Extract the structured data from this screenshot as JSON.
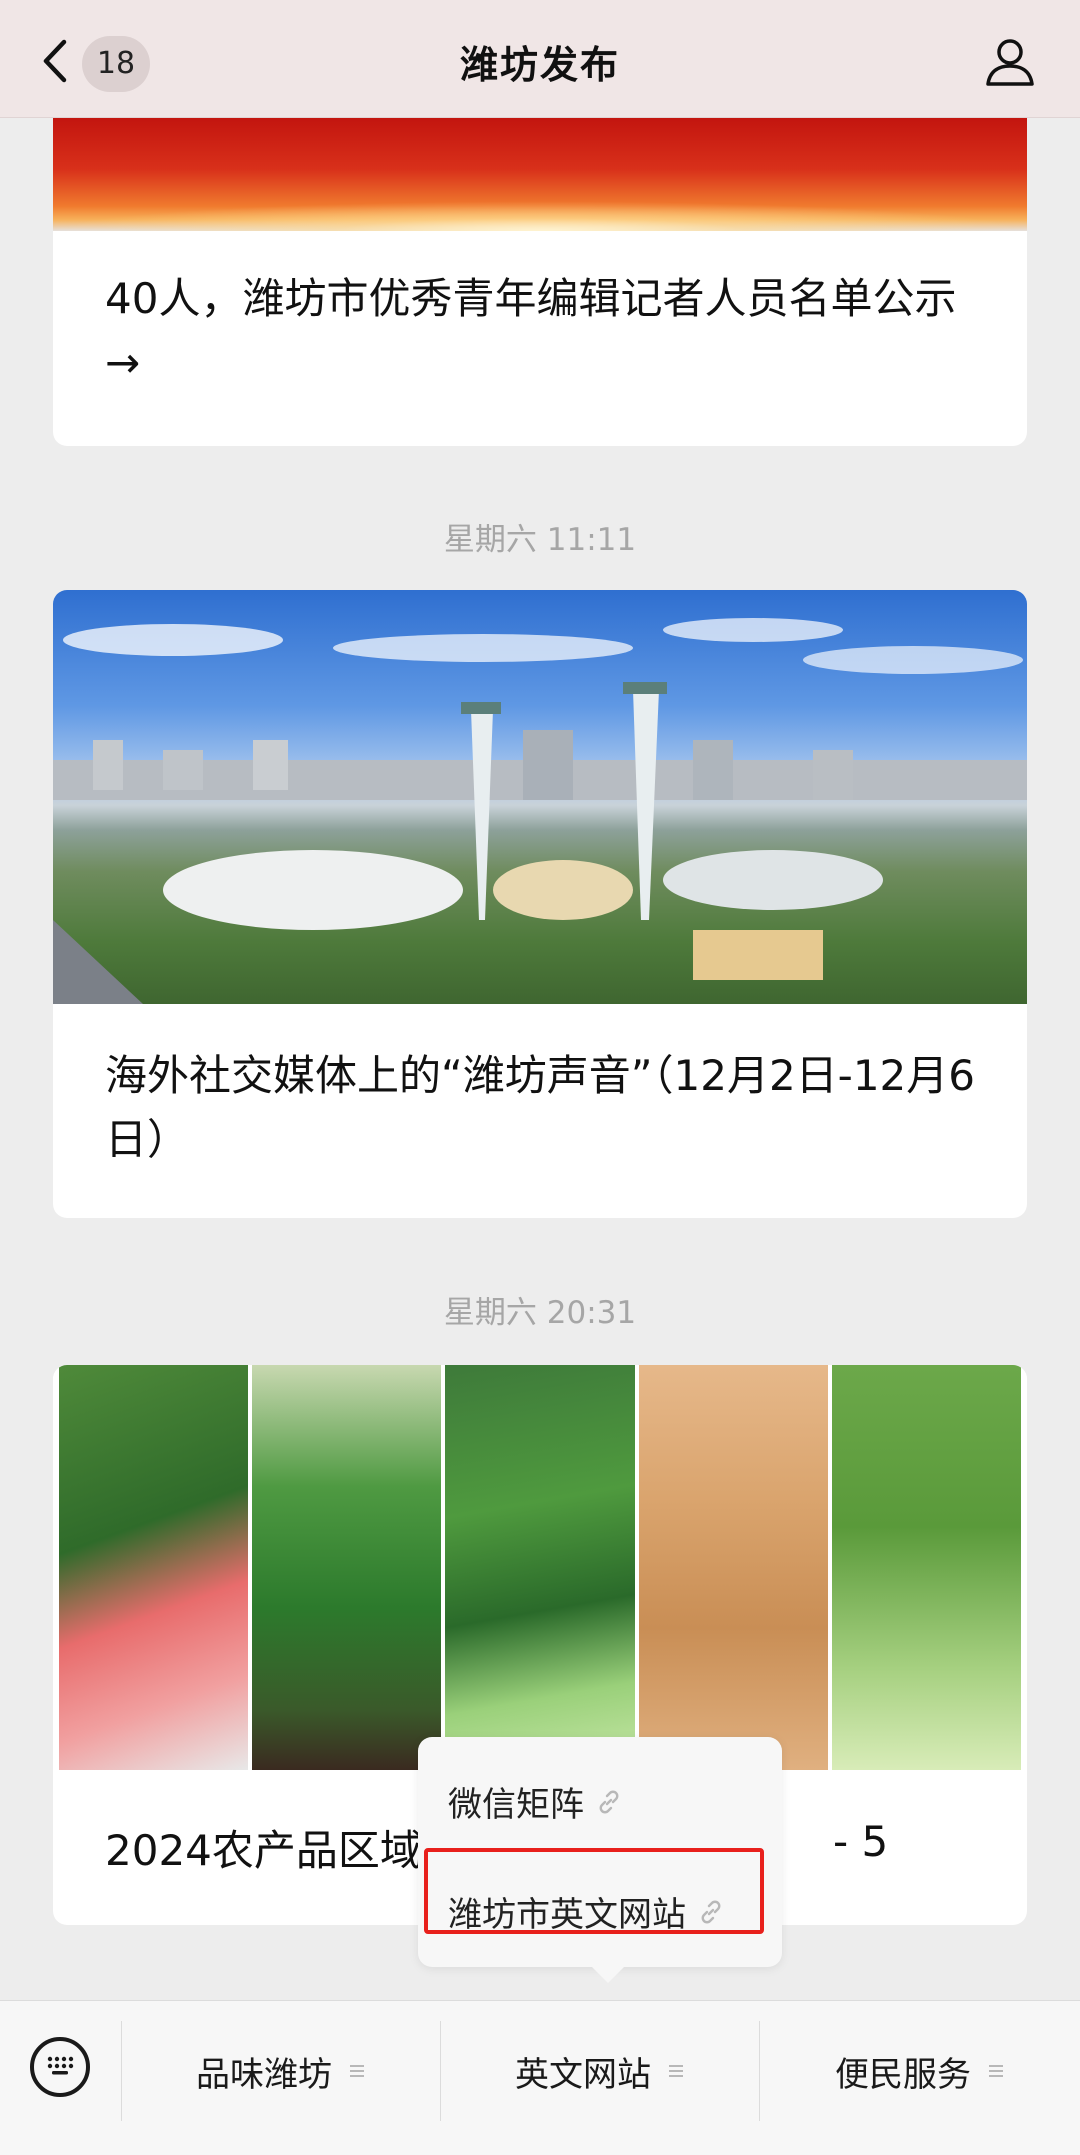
{
  "header": {
    "title": "潍坊发布",
    "unread_count": "18"
  },
  "articles": [
    {
      "title": "40人，潍坊市优秀青年编辑记者人员名单公示→"
    },
    {
      "time": "星期六 11:11",
      "title": "海外社交媒体上的“潍坊声音”（12月2日-12月6日）"
    },
    {
      "time": "星期六 20:31",
      "title": "2024农产品区域",
      "title_tail": "- 5"
    }
  ],
  "popup": {
    "items": [
      {
        "label": "微信矩阵",
        "icon": "link-icon"
      },
      {
        "label": "潍坊市英文网站",
        "icon": "link-icon"
      }
    ]
  },
  "bottom_menu": {
    "items": [
      {
        "label": "品味潍坊"
      },
      {
        "label": "英文网站"
      },
      {
        "label": "便民服务"
      }
    ]
  },
  "colors": {
    "highlight": "#e8201c",
    "header_bg": "#f0e6e6",
    "page_bg": "#ededed"
  }
}
